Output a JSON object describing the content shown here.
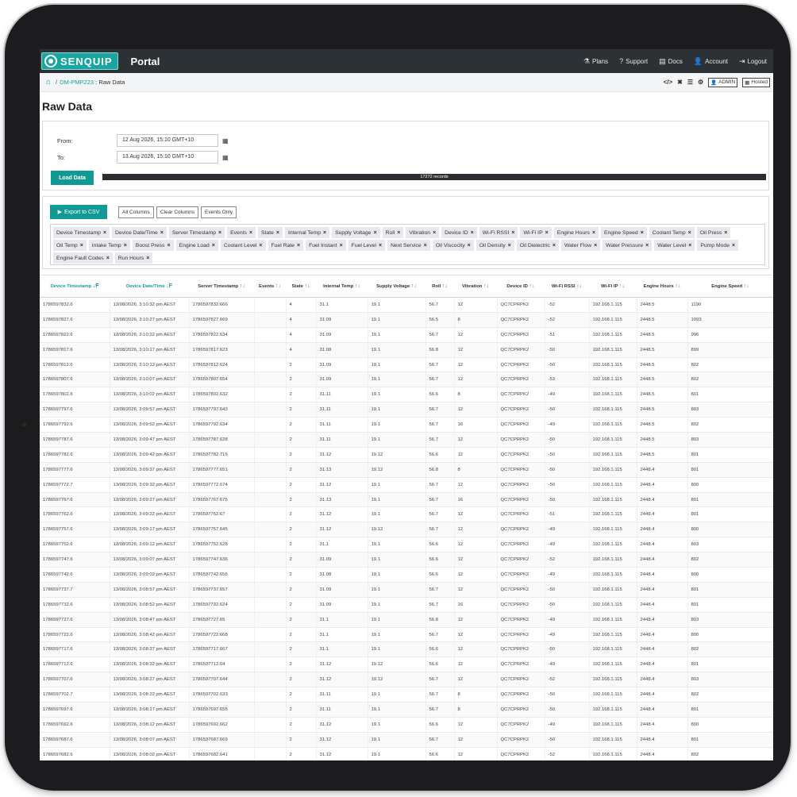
{
  "nav": {
    "logo_text": "SENQUIP",
    "title": "Portal",
    "links": [
      {
        "icon": "⚗",
        "label": "Plans"
      },
      {
        "icon": "?",
        "label": "Support"
      },
      {
        "icon": "▤",
        "label": "Docs"
      },
      {
        "icon": "👤",
        "label": "Account"
      },
      {
        "icon": "⇥",
        "label": "Logout"
      }
    ]
  },
  "breadcrumb": {
    "device": "DM-PMP223",
    "sep": "/",
    "current": "Raw Data",
    "tools": [
      "</>",
      "✖",
      "☰",
      "⚙"
    ],
    "admin_label": "ADMIN",
    "hosted_label": "Hosted"
  },
  "page_title": "Raw Data",
  "range": {
    "from_label": "From:",
    "from_value": "12 Aug 2026, 15:10 GMT+10",
    "to_label": "To:",
    "to_value": "13 Aug 2026, 15:10 GMT+10",
    "load_label": "Load Data",
    "records_label": "17272 records",
    "progress": 1.0
  },
  "columns_panel": {
    "export_label": "Export to CSV",
    "all_columns": "All Columns",
    "clear_columns": "Clear Columns",
    "events_only": "Events Only",
    "chips": [
      "Device Timestamp",
      "Device Date/Time",
      "Server Timestamp",
      "Events",
      "State",
      "Internal Temp",
      "Supply Voltage",
      "Roll",
      "Vibration",
      "Device ID",
      "Wi-Fi RSSI",
      "Wi-Fi IP",
      "Engine Hours",
      "Engine Speed",
      "Coolant Temp",
      "Oil Press",
      "Oil Temp",
      "Intake Temp",
      "Boost Press",
      "Engine Load",
      "Coolant Level",
      "Fuel Rate",
      "Fuel Instant",
      "Fuel Level",
      "Next Service",
      "Oil Viscocity",
      "Oil Density",
      "Oil Dielectric",
      "Water Flow",
      "Water Pressure",
      "Water Level",
      "Pump Mode",
      "Engine Fault Codes",
      "Run Hours"
    ]
  },
  "table": {
    "headers": [
      {
        "label": "Device Timestamp",
        "sort": "↓F",
        "sorted": true
      },
      {
        "label": "Device Date/Time",
        "sort": "↓F",
        "sorted": true
      },
      {
        "label": "Server Timestamp",
        "sort": "↑↓",
        "sorted": false
      },
      {
        "label": "Events",
        "sort": "↑↓",
        "sorted": false
      },
      {
        "label": "State",
        "sort": "↑↓",
        "sorted": false
      },
      {
        "label": "Internal Temp",
        "sort": "↑↓",
        "sorted": false
      },
      {
        "label": "Supply Voltage",
        "sort": "↑↓",
        "sorted": false
      },
      {
        "label": "Roll",
        "sort": "↑↓",
        "sorted": false
      },
      {
        "label": "Vibration",
        "sort": "↑↓",
        "sorted": false
      },
      {
        "label": "Device ID",
        "sort": "↑↓",
        "sorted": false
      },
      {
        "label": "Wi-Fi RSSI",
        "sort": "↑↓",
        "sorted": false
      },
      {
        "label": "Wi-Fi IP",
        "sort": "↑↓",
        "sorted": false
      },
      {
        "label": "Engine Hours",
        "sort": "↑↓",
        "sorted": false
      },
      {
        "label": "Engine Speed",
        "sort": "↑↓",
        "sorted": false
      }
    ],
    "rows": [
      [
        "1786597832.6",
        "13/08/2026, 3:10:32 pm AEST",
        "1786597832.666",
        "",
        "4",
        "31.1",
        "19.1",
        "56.7",
        "12",
        "QC7CPRPK2",
        "-52",
        "192.168.1.115",
        "2448.5",
        "1190"
      ],
      [
        "1786597827.6",
        "13/08/2026, 3:10:27 pm AEST",
        "1786597827.669",
        "",
        "4",
        "31.09",
        "19.1",
        "56.5",
        "8",
        "QC7CPRPK2",
        "-52",
        "192.168.1.115",
        "2448.5",
        "1093"
      ],
      [
        "1786597822.6",
        "13/08/2026, 3:10:22 pm AEST",
        "1786597822.634",
        "",
        "4",
        "31.09",
        "19.1",
        "56.7",
        "12",
        "QC7CPRPK2",
        "-51",
        "192.168.1.115",
        "2448.5",
        "996"
      ],
      [
        "1786597817.6",
        "13/08/2026, 3:10:17 pm AEST",
        "1786597817.623",
        "",
        "4",
        "31.08",
        "19.1",
        "56.8",
        "12",
        "QC7CPRPK2",
        "-50",
        "192.168.1.115",
        "2448.5",
        "899"
      ],
      [
        "1786597812.6",
        "13/08/2026, 3:10:12 pm AEST",
        "1786597812.624",
        "",
        "2",
        "31.09",
        "19.1",
        "56.7",
        "12",
        "QC7CPRPK2",
        "-50",
        "192.168.1.115",
        "2448.5",
        "802"
      ],
      [
        "1786597807.6",
        "13/08/2026, 3:10:07 pm AEST",
        "1786597807.654",
        "",
        "2",
        "31.09",
        "19.1",
        "56.7",
        "12",
        "QC7CPRPK2",
        "-53",
        "192.168.1.115",
        "2448.5",
        "802"
      ],
      [
        "1786597802.6",
        "13/08/2026, 3:10:02 pm AEST",
        "1786597802.632",
        "",
        "2",
        "31.11",
        "19.1",
        "56.6",
        "8",
        "QC7CPRPK2",
        "-49",
        "192.168.1.115",
        "2448.5",
        "801"
      ],
      [
        "1786597797.6",
        "13/08/2026, 3:09:57 pm AEST",
        "1786597797.643",
        "",
        "2",
        "31.11",
        "19.1",
        "56.7",
        "12",
        "QC7CPRPK2",
        "-50",
        "192.168.1.115",
        "2448.5",
        "803"
      ],
      [
        "1786597792.6",
        "13/08/2026, 3:09:52 pm AEST",
        "1786597792.634",
        "",
        "2",
        "31.11",
        "19.1",
        "56.7",
        "16",
        "QC7CPRPK2",
        "-49",
        "192.168.1.115",
        "2448.5",
        "802"
      ],
      [
        "1786597787.6",
        "13/08/2026, 3:09:47 pm AEST",
        "1786597787.628",
        "",
        "2",
        "31.11",
        "19.1",
        "56.7",
        "12",
        "QC7CPRPK2",
        "-50",
        "192.168.1.115",
        "2448.5",
        "803"
      ],
      [
        "1786597782.6",
        "13/08/2026, 3:09:42 pm AEST",
        "1786597782.715",
        "",
        "2",
        "31.12",
        "19.12",
        "56.6",
        "12",
        "QC7CPRPK2",
        "-50",
        "192.168.1.115",
        "2448.5",
        "801"
      ],
      [
        "1786597777.6",
        "13/08/2026, 3:09:37 pm AEST",
        "1786597777.651",
        "",
        "2",
        "31.13",
        "19.12",
        "56.8",
        "8",
        "QC7CPRPK2",
        "-50",
        "192.168.1.115",
        "2448.4",
        "801"
      ],
      [
        "1786597772.7",
        "13/08/2026, 3:09:32 pm AEST",
        "1786597772.674",
        "",
        "2",
        "31.12",
        "19.1",
        "56.7",
        "12",
        "QC7CPRPK2",
        "-50",
        "192.168.1.115",
        "2448.4",
        "800"
      ],
      [
        "1786597767.6",
        "13/08/2026, 3:09:27 pm AEST",
        "1786597767.675",
        "",
        "2",
        "31.13",
        "19.1",
        "56.7",
        "16",
        "QC7CPRPK2",
        "-50",
        "192.168.1.115",
        "2448.4",
        "801"
      ],
      [
        "1786597762.6",
        "13/08/2026, 3:09:22 pm AEST",
        "1786597762.67",
        "",
        "2",
        "31.12",
        "19.1",
        "56.7",
        "12",
        "QC7CPRPK2",
        "-51",
        "192.168.1.115",
        "2448.4",
        "801"
      ],
      [
        "1786597757.6",
        "13/08/2026, 3:09:17 pm AEST",
        "1786597757.645",
        "",
        "2",
        "31.12",
        "19.12",
        "56.7",
        "12",
        "QC7CPRPK2",
        "-49",
        "192.168.1.115",
        "2448.4",
        "800"
      ],
      [
        "1786597752.6",
        "13/08/2026, 3:09:12 pm AEST",
        "1786597752.628",
        "",
        "2",
        "31.1",
        "19.1",
        "56.6",
        "12",
        "QC7CPRPK2",
        "-49",
        "192.168.1.115",
        "2448.4",
        "803"
      ],
      [
        "1786597747.6",
        "13/08/2026, 3:09:07 pm AEST",
        "1786597747.636",
        "",
        "2",
        "31.09",
        "19.1",
        "56.6",
        "12",
        "QC7CPRPK2",
        "-52",
        "192.168.1.115",
        "2448.4",
        "802"
      ],
      [
        "1786597742.6",
        "13/08/2026, 3:09:02 pm AEST",
        "1786597742.656",
        "",
        "2",
        "31.08",
        "19.1",
        "56.6",
        "12",
        "QC7CPRPK2",
        "-49",
        "192.168.1.115",
        "2448.4",
        "800"
      ],
      [
        "1786597737.7",
        "13/08/2026, 3:08:57 pm AEST",
        "1786597737.657",
        "",
        "2",
        "31.09",
        "19.1",
        "56.7",
        "12",
        "QC7CPRPK2",
        "-50",
        "192.168.1.115",
        "2448.4",
        "801"
      ],
      [
        "1786597732.6",
        "13/08/2026, 3:08:52 pm AEST",
        "1786597732.624",
        "",
        "2",
        "31.09",
        "19.1",
        "56.7",
        "16",
        "QC7CPRPK2",
        "-50",
        "192.168.1.115",
        "2448.4",
        "801"
      ],
      [
        "1786597727.6",
        "13/08/2026, 3:08:47 pm AEST",
        "1786597727.65",
        "",
        "2",
        "31.1",
        "19.1",
        "56.8",
        "12",
        "QC7CPRPK2",
        "-49",
        "192.168.1.115",
        "2448.4",
        "803"
      ],
      [
        "1786597722.6",
        "13/08/2026, 3:08:42 pm AEST",
        "1786597722.668",
        "",
        "2",
        "31.1",
        "19.1",
        "56.7",
        "12",
        "QC7CPRPK2",
        "-49",
        "192.168.1.115",
        "2448.4",
        "800"
      ],
      [
        "1786597717.6",
        "13/08/2026, 3:08:37 pm AEST",
        "1786597717.667",
        "",
        "2",
        "31.1",
        "19.1",
        "56.6",
        "12",
        "QC7CPRPK2",
        "-50",
        "192.168.1.115",
        "2448.4",
        "802"
      ],
      [
        "1786597712.6",
        "13/08/2026, 3:08:32 pm AEST",
        "1786597712.64",
        "",
        "2",
        "31.12",
        "19.12",
        "56.6",
        "12",
        "QC7CPRPK2",
        "-49",
        "192.168.1.115",
        "2448.4",
        "801"
      ],
      [
        "1786597707.6",
        "13/08/2026, 3:08:27 pm AEST",
        "1786597707.644",
        "",
        "2",
        "31.12",
        "19.12",
        "56.7",
        "12",
        "QC7CPRPK2",
        "-52",
        "192.168.1.115",
        "2448.4",
        "803"
      ],
      [
        "1786597702.7",
        "13/08/2026, 3:08:22 pm AEST",
        "1786597702.633",
        "",
        "2",
        "31.11",
        "19.1",
        "56.7",
        "8",
        "QC7CPRPK2",
        "-50",
        "192.168.1.115",
        "2448.4",
        "802"
      ],
      [
        "1786597697.6",
        "13/08/2026, 3:08:17 pm AEST",
        "1786597697.655",
        "",
        "2",
        "31.11",
        "19.1",
        "56.7",
        "8",
        "QC7CPRPK2",
        "-50",
        "192.168.1.115",
        "2448.4",
        "801"
      ],
      [
        "1786597692.6",
        "13/08/2026, 3:08:12 pm AEST",
        "1786597692.662",
        "",
        "2",
        "31.12",
        "19.1",
        "56.6",
        "12",
        "QC7CPRPK2",
        "-49",
        "192.168.1.115",
        "2448.4",
        "800"
      ],
      [
        "1786597687.6",
        "13/08/2026, 3:08:07 pm AEST",
        "1786597687.669",
        "",
        "2",
        "31.12",
        "19.1",
        "56.7",
        "12",
        "QC7CPRPK2",
        "-50",
        "192.168.1.115",
        "2448.4",
        "801"
      ],
      [
        "1786597682.6",
        "13/08/2026, 3:08:02 pm AEST",
        "1786597682.641",
        "",
        "2",
        "31.12",
        "19.1",
        "56.6",
        "12",
        "QC7CPRPK2",
        "-52",
        "192.168.1.115",
        "2448.4",
        "802"
      ]
    ]
  },
  "colors": {
    "accent": "#119a94",
    "navbar": "#2c3136",
    "progress": "#2b2f33"
  }
}
